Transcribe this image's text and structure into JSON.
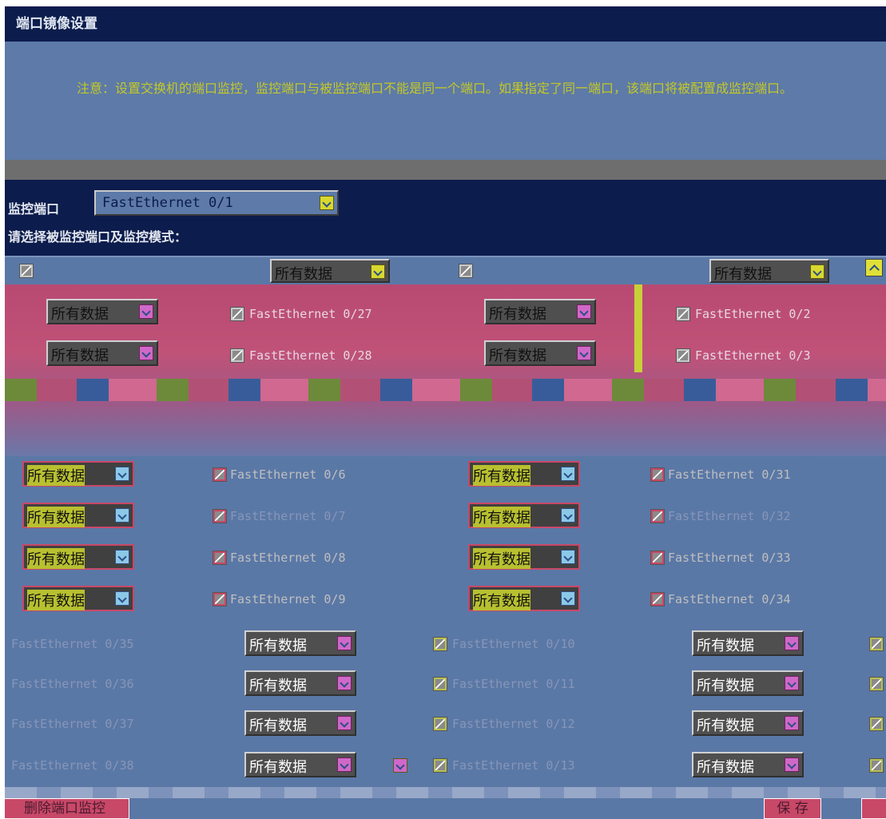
{
  "page_title": "端口镜像设置",
  "notice": "注意：设置交换机的端口监控，监控端口与被监控端口不能是同一个端口。如果指定了同一端口，该端口将被配置成监控端口。",
  "monitor": {
    "label": "监控端口",
    "value": "FastEthernet 0/1"
  },
  "choose_label": "请选择被监控端口及监控模式：",
  "mode_option": "所有数据",
  "left_ports": [
    {
      "name": "FastEthernet 0/6",
      "mode": "所有数据"
    },
    {
      "name": "FastEthernet 0/7",
      "mode": "所有数据"
    },
    {
      "name": "FastEthernet 0/8",
      "mode": "所有数据"
    },
    {
      "name": "FastEthernet 0/9",
      "mode": "所有数据"
    },
    {
      "name": "FastEthernet 0/10",
      "mode": "所有数据"
    },
    {
      "name": "FastEthernet 0/11",
      "mode": "所有数据"
    },
    {
      "name": "FastEthernet 0/12",
      "mode": "所有数据"
    },
    {
      "name": "FastEthernet 0/13",
      "mode": "所有数据"
    }
  ],
  "right_ports": [
    {
      "name": "FastEthernet 0/31",
      "mode": "所有数据"
    },
    {
      "name": "FastEthernet 0/32",
      "mode": "所有数据"
    },
    {
      "name": "FastEthernet 0/33",
      "mode": "所有数据"
    },
    {
      "name": "FastEthernet 0/34",
      "mode": "所有数据"
    },
    {
      "name": "FastEthernet 0/35",
      "mode": "所有数据"
    },
    {
      "name": "FastEthernet 0/36",
      "mode": "所有数据"
    },
    {
      "name": "FastEthernet 0/37",
      "mode": "所有数据"
    },
    {
      "name": "FastEthernet 0/38",
      "mode": "所有数据"
    }
  ],
  "upper_ports": [
    {
      "name": "FastEthernet 0/27",
      "mode": "所有数据"
    },
    {
      "name": "FastEthernet 0/2",
      "mode": "所有数据"
    },
    {
      "name": "FastEthernet 0/28",
      "mode": "所有数据"
    },
    {
      "name": "FastEthernet 0/3",
      "mode": "所有数据"
    }
  ],
  "buttons": {
    "delete": "删除端口监控",
    "save": "保 存"
  }
}
